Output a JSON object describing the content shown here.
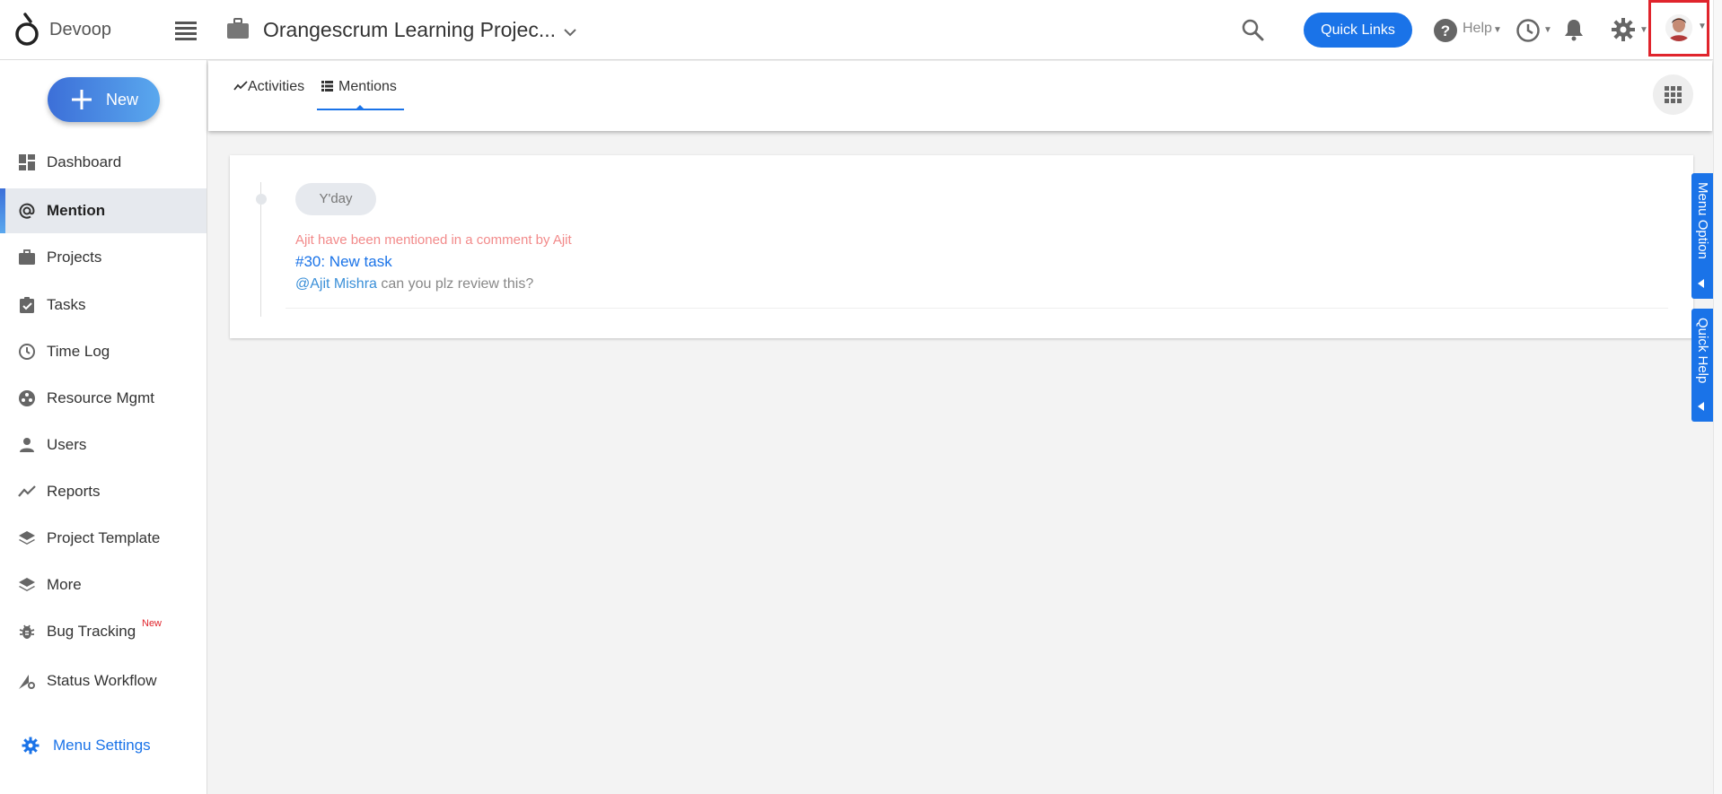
{
  "header": {
    "brand": "Devoop",
    "project_title": "Orangescrum Learning Projec...",
    "quick_links": "Quick Links",
    "help": "Help"
  },
  "sidebar": {
    "new_label": "New",
    "items": [
      {
        "label": "Dashboard",
        "icon": "dashboard-icon"
      },
      {
        "label": "Mention",
        "icon": "at-icon"
      },
      {
        "label": "Projects",
        "icon": "briefcase-icon"
      },
      {
        "label": "Tasks",
        "icon": "clipboard-check-icon"
      },
      {
        "label": "Time Log",
        "icon": "clock-icon"
      },
      {
        "label": "Resource Mgmt",
        "icon": "resource-icon"
      },
      {
        "label": "Users",
        "icon": "user-icon"
      },
      {
        "label": "Reports",
        "icon": "chart-line-icon"
      },
      {
        "label": "Project Template",
        "icon": "layers-icon"
      },
      {
        "label": "More",
        "icon": "layers-icon"
      },
      {
        "label": "Bug Tracking",
        "icon": "bug-icon",
        "badge": "New"
      },
      {
        "label": "Status Workflow",
        "icon": "workflow-icon"
      }
    ],
    "menu_settings": "Menu Settings"
  },
  "tabs": {
    "activities": "Activities",
    "mentions": "Mentions"
  },
  "mention": {
    "date": "Y'day",
    "heading": "Ajit have been mentioned in a comment by Ajit",
    "task": "#30: New task",
    "user": "@Ajit Mishra",
    "comment": " can you plz review this?"
  },
  "side_tabs": {
    "menu_option": "Menu Option",
    "quick_help": "Quick Help"
  },
  "colors": {
    "accent": "#1a73e8",
    "mention_heading": "#f28a8a",
    "highlight_border": "#e0242c"
  }
}
